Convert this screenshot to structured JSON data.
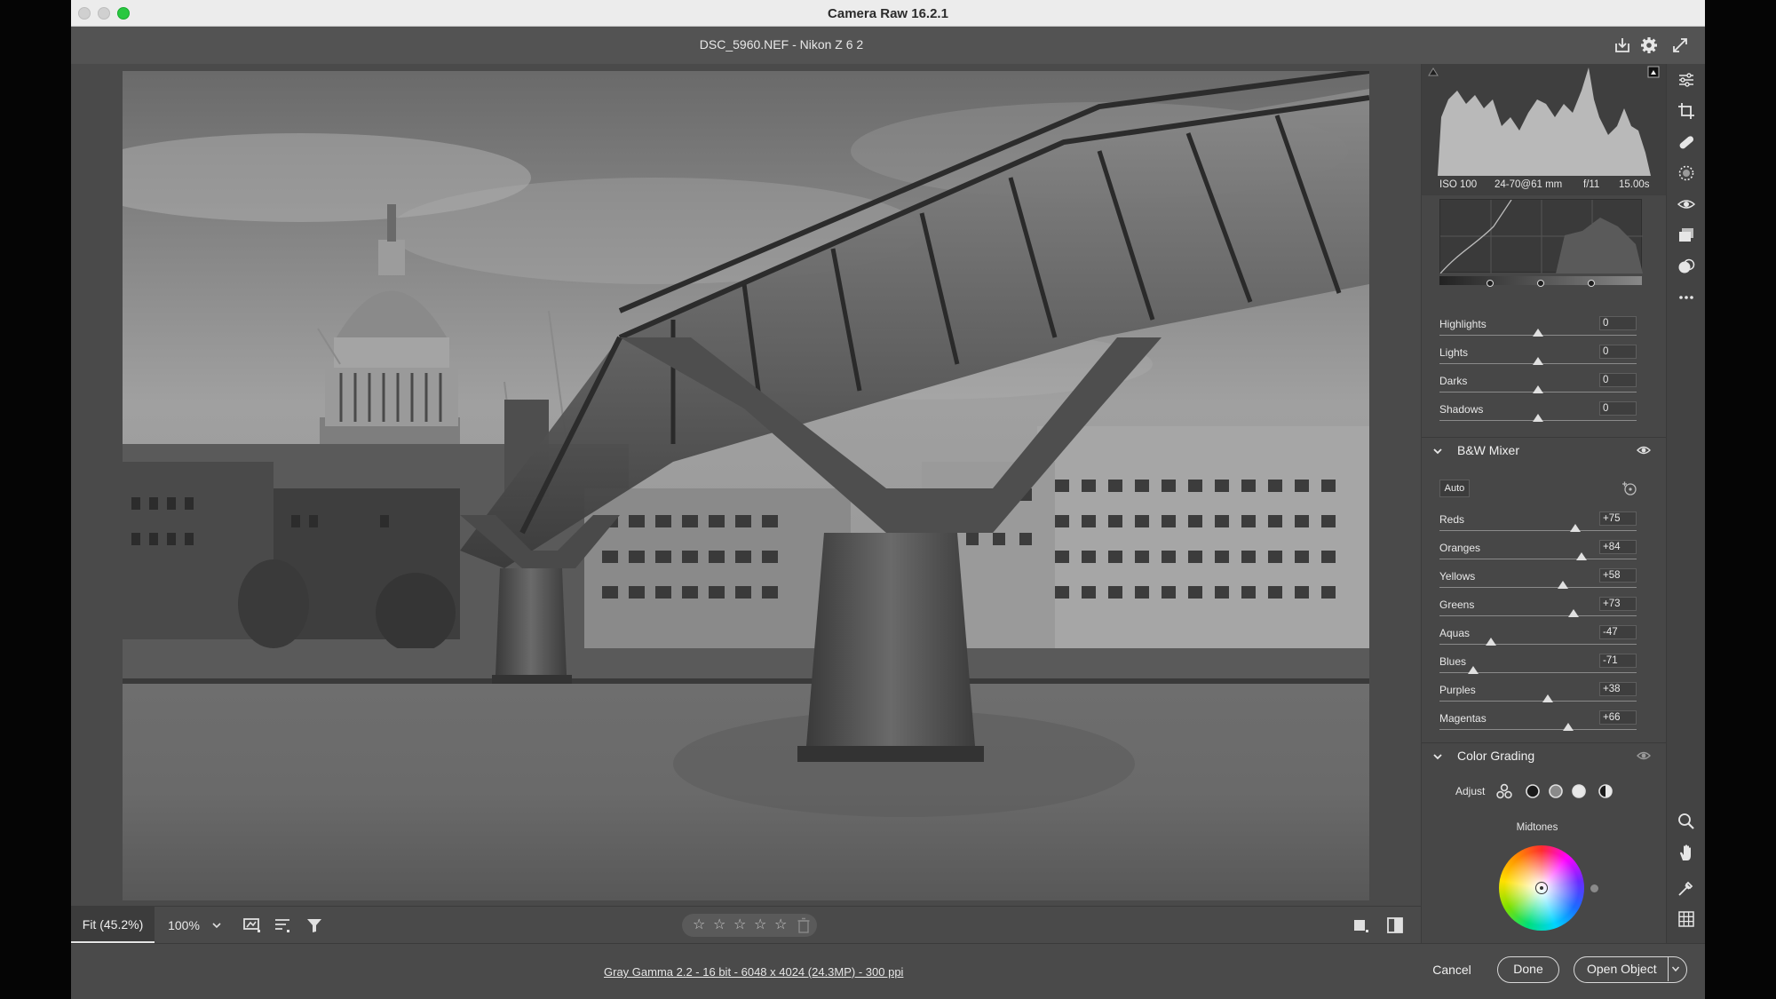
{
  "window": {
    "title": "Camera Raw 16.2.1"
  },
  "header": {
    "file_title": "DSC_5960.NEF  -  Nikon Z 6 2"
  },
  "histogram": {
    "iso": "ISO 100",
    "lens": "24-70@61 mm",
    "aperture": "f/11",
    "shutter": "15.00s"
  },
  "curve_sliders": [
    {
      "label": "Highlights",
      "value": "0",
      "position": 0.5
    },
    {
      "label": "Lights",
      "value": "0",
      "position": 0.5
    },
    {
      "label": "Darks",
      "value": "0",
      "position": 0.5
    },
    {
      "label": "Shadows",
      "value": "0",
      "position": 0.5
    }
  ],
  "bw_mixer": {
    "title": "B&W Mixer",
    "auto_label": "Auto",
    "sliders": [
      {
        "label": "Reds",
        "value": "+75",
        "position": 0.687
      },
      {
        "label": "Oranges",
        "value": "+84",
        "position": 0.72
      },
      {
        "label": "Yellows",
        "value": "+58",
        "position": 0.624
      },
      {
        "label": "Greens",
        "value": "+73",
        "position": 0.68
      },
      {
        "label": "Aquas",
        "value": "-47",
        "position": 0.26
      },
      {
        "label": "Blues",
        "value": "-71",
        "position": 0.17
      },
      {
        "label": "Purples",
        "value": "+38",
        "position": 0.55
      },
      {
        "label": "Magentas",
        "value": "+66",
        "position": 0.654
      }
    ]
  },
  "color_grading": {
    "title": "Color Grading",
    "adjust_label": "Adjust",
    "wheel_label": "Midtones"
  },
  "bottom_toolbar": {
    "zoom_fit": "Fit (45.2%)",
    "zoom_100": "100%",
    "rating_stars": [
      "☆",
      "☆",
      "☆",
      "☆",
      "☆"
    ]
  },
  "footer": {
    "workflow": "Gray Gamma 2.2 - 16 bit - 6048 x 4024 (24.3MP) - 300 ppi",
    "cancel": "Cancel",
    "done": "Done",
    "open": "Open Object"
  },
  "tools": [
    "edit-icon",
    "crop-icon",
    "healing-icon",
    "masking-icon",
    "red-eye-icon",
    "snapshots-icon",
    "presets-icon",
    "more-icon",
    "zoom-icon",
    "hand-icon",
    "color-sampler-icon",
    "grid-icon"
  ],
  "colors": {
    "window_bg": "#4d4d4d",
    "panel_bg": "#474747",
    "accent_green": "#28c840"
  }
}
